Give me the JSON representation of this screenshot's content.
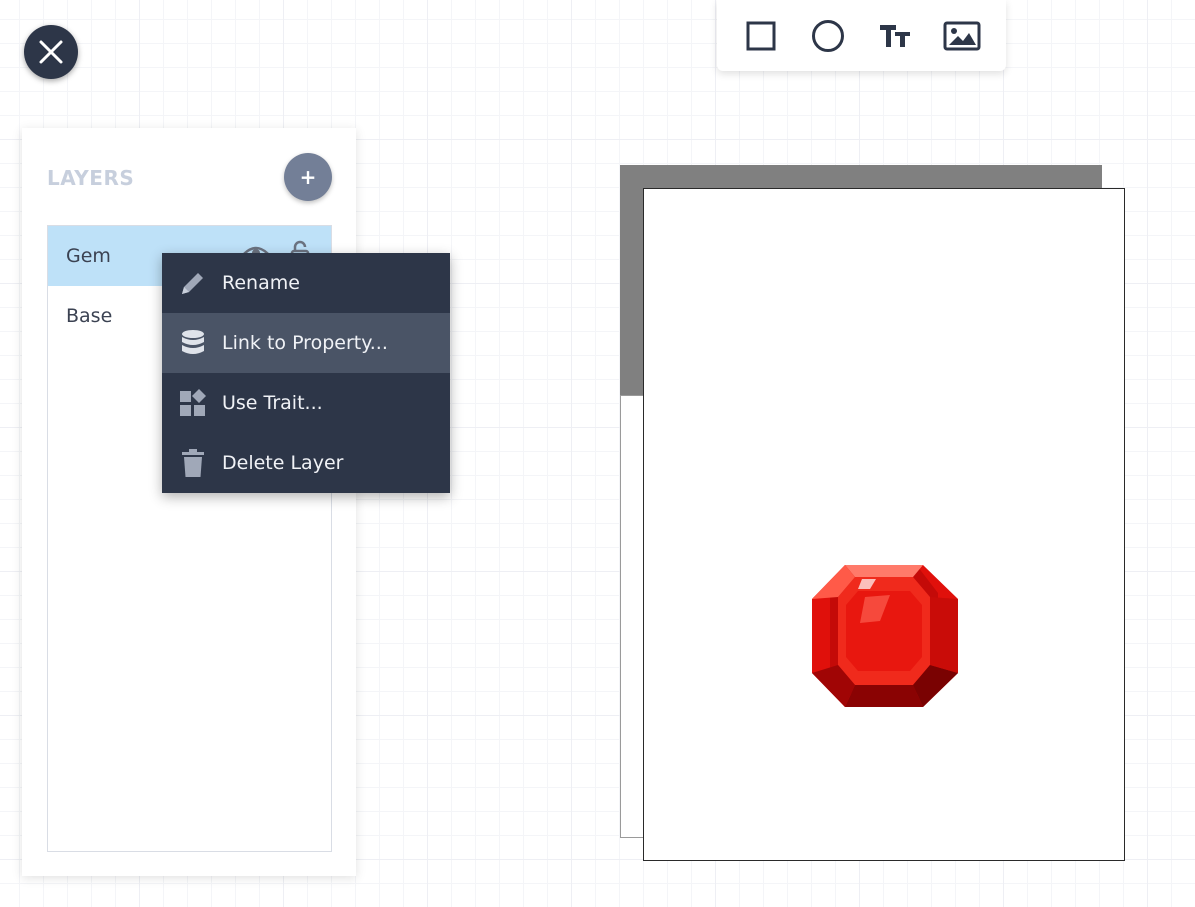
{
  "toolbar": {
    "tools": [
      {
        "icon": "rectangle-tool-icon"
      },
      {
        "icon": "ellipse-tool-icon"
      },
      {
        "icon": "text-tool-icon"
      },
      {
        "icon": "image-tool-icon"
      }
    ]
  },
  "layers_panel": {
    "title": "LAYERS",
    "add_label": "+",
    "layers": [
      {
        "name": "Gem",
        "selected": true
      },
      {
        "name": "Base",
        "selected": false
      }
    ]
  },
  "context_menu": {
    "items": [
      {
        "label": "Rename",
        "icon": "pencil-icon"
      },
      {
        "label": "Link to Property...",
        "icon": "database-icon",
        "hovered": true
      },
      {
        "label": "Use Trait...",
        "icon": "shapes-icon"
      },
      {
        "label": "Delete Layer",
        "icon": "trash-icon"
      }
    ]
  },
  "colors": {
    "dark": "#2d3648",
    "menu_hover": "#4a5466",
    "selection": "#bee1f8",
    "title_muted": "#c7cfdd",
    "add_button": "#737f97",
    "gem_red": "#e0100b"
  }
}
